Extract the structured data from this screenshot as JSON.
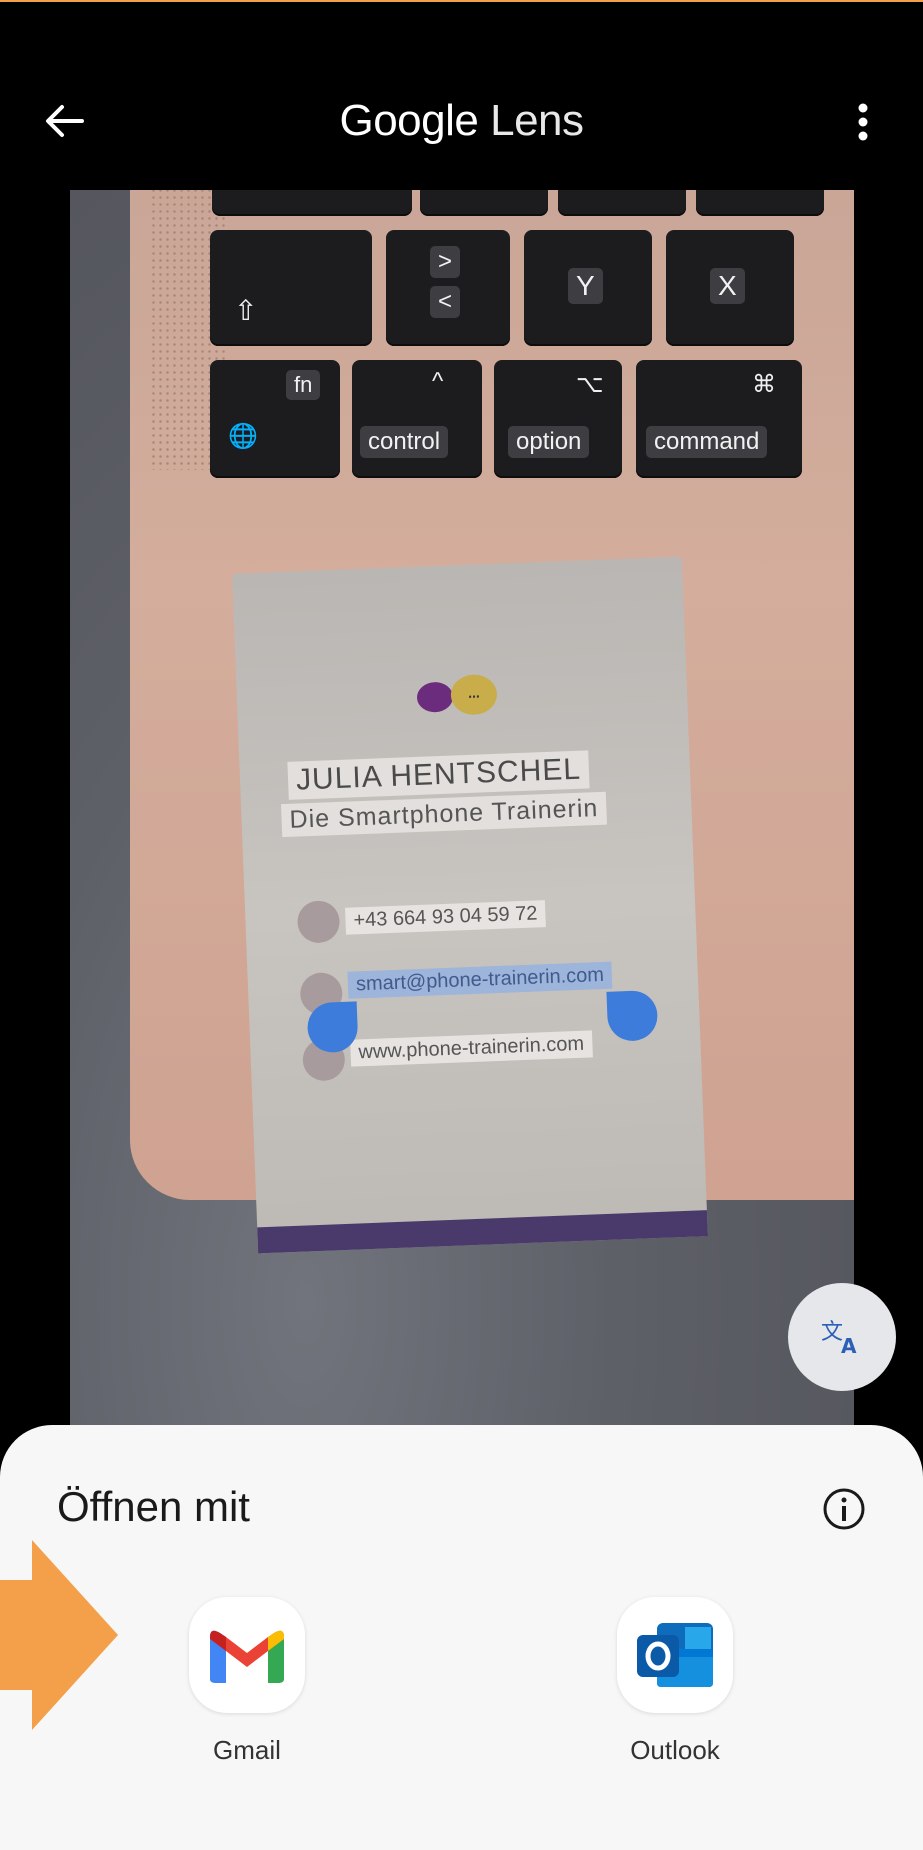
{
  "app_bar": {
    "title_google": "Google",
    "title_lens": "Lens",
    "back_icon": "arrow-back-icon",
    "more_icon": "more-vert-icon"
  },
  "preview": {
    "keyboard": {
      "arrow_up_label": ">",
      "arrow_down_label": "<",
      "y_label": "Y",
      "x_label": "X",
      "shift_label": "⇧",
      "fn_label": "fn",
      "globe_label": "🌐",
      "control_symbol": "^",
      "control_label": "control",
      "option_symbol": "⌥",
      "option_label": "option",
      "command_symbol": "⌘",
      "command_label": "command"
    },
    "card": {
      "name": "JULIA HENTSCHEL",
      "role": "Die Smartphone Trainerin",
      "phone": "+43 664 93 04 59 72",
      "email": "smart@phone-trainerin.com",
      "website": "www.phone-trainerin.com",
      "logo_dots": "..."
    }
  },
  "translate_fab": {
    "icon": "translate-icon"
  },
  "sheet": {
    "title": "Öffnen mit",
    "info_icon": "info-icon",
    "apps": [
      {
        "label": "Gmail",
        "icon": "gmail-icon"
      },
      {
        "label": "Outlook",
        "icon": "outlook-icon"
      }
    ]
  },
  "colors": {
    "selection": "#3d7cdb",
    "annotation_arrow": "#f4a04a",
    "sheet_bg": "#f7f7f7"
  }
}
